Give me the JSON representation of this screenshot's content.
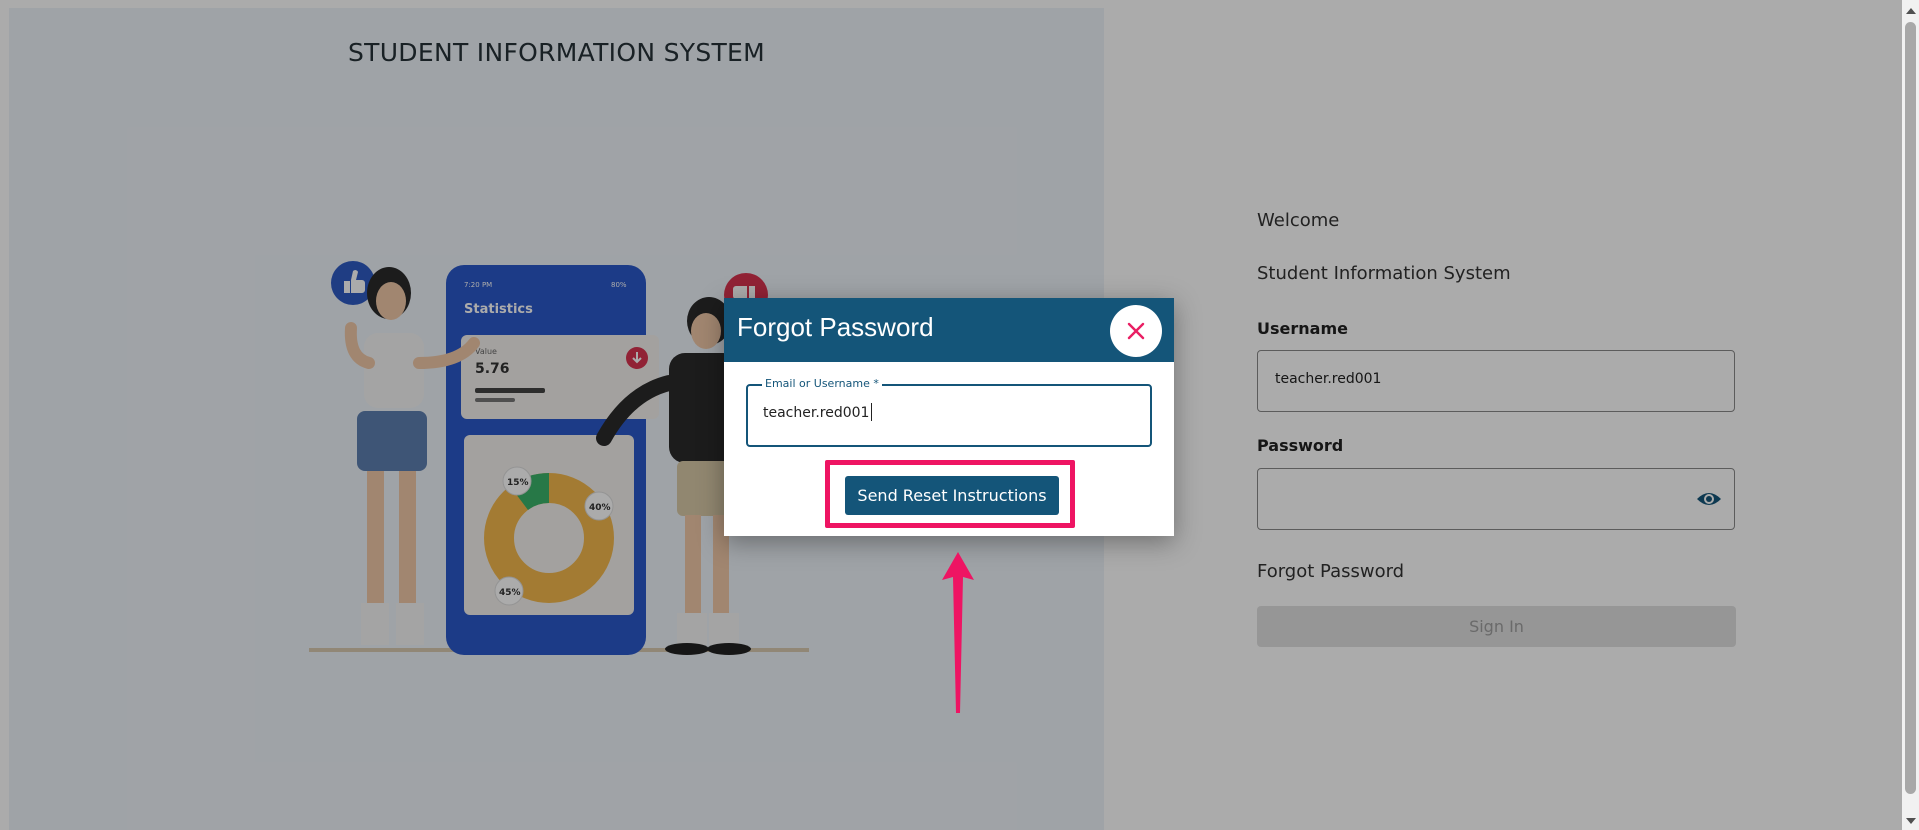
{
  "hero": {
    "title": "STUDENT INFORMATION SYSTEM",
    "phone": {
      "time": "7:20 PM",
      "battery": "80%",
      "heading": "Statistics",
      "value_label": "Value",
      "value": "5.76",
      "donut_labels": [
        "15%",
        "40%",
        "45%"
      ]
    }
  },
  "login": {
    "welcome": "Welcome",
    "subtitle": "Student Information System",
    "username_label": "Username",
    "username_value": "teacher.red001",
    "password_label": "Password",
    "forgot_password": "Forgot Password",
    "sign_in": "Sign In"
  },
  "modal": {
    "title": "Forgot Password",
    "field_label": "Email or Username *",
    "field_value": "teacher.red001",
    "send_button": "Send Reset Instructions"
  },
  "colors": {
    "primary": "#145579",
    "highlight": "#ee1463",
    "close_icon": "#e91e63"
  },
  "icons": [
    "close-icon",
    "eye-icon",
    "thumbs-up-icon",
    "thumbs-down-icon",
    "arrow-up-icon"
  ]
}
